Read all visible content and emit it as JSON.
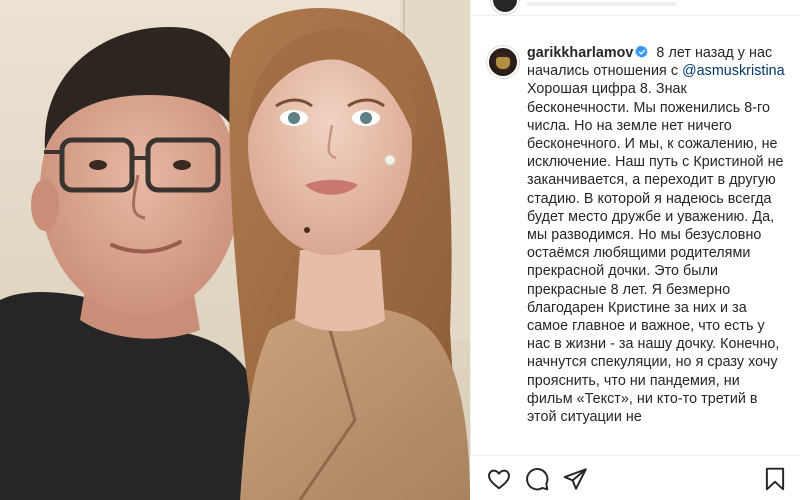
{
  "post": {
    "username": "garikkharlamov",
    "mention": "@asmuskristina",
    "caption_intro": " 8 лет назад у нас начались отношения с ",
    "caption_body": "Хорошая цифра 8. Знак бесконечности. Мы поженились 8-го числа. Но на земле нет ничего бесконечного. И мы, к сожалению, не исключение. Наш путь с Кристиной не заканчивается, а переходит в другую стадию. В которой я надеюсь всегда будет место дружбе и уважению. Да, мы разводимся. Но мы безусловно остаёмся любящими родителями прекрасной дочки. Это были прекрасные 8 лет. Я безмерно благодарен Кристине за них и за самое главное и важное, что есть у нас в жизни - за нашу дочку. Конечно, начнутся спекуляции, но я сразу хочу прояснить, что ни пандемия, ни фильм «Текст», ни кто-то третий в этой ситуации не"
  },
  "icons": {
    "verified": "verified-badge-icon",
    "like": "heart-icon",
    "comment": "comment-icon",
    "share": "paper-plane-icon",
    "save": "bookmark-icon"
  },
  "colors": {
    "verified": "#3897f0",
    "mention": "#00376b",
    "text": "#262626"
  }
}
